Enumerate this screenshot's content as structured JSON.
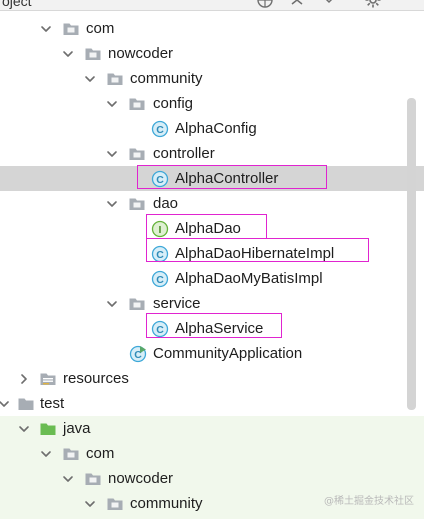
{
  "panel": {
    "title": "oject",
    "toolbar": [
      "globe-icon",
      "collapse-all-icon",
      "settings-icon"
    ]
  },
  "tree": {
    "com": "com",
    "nowcoder": "nowcoder",
    "community": "community",
    "config": "config",
    "alpha_config": "AlphaConfig",
    "controller": "controller",
    "alpha_controller": "AlphaController",
    "dao": "dao",
    "alpha_dao": "AlphaDao",
    "alpha_dao_hibernate_impl": "AlphaDaoHibernateImpl",
    "alpha_dao_mybatis_impl": "AlphaDaoMyBatisImpl",
    "service": "service",
    "alpha_service": "AlphaService",
    "community_application": "CommunityApplication",
    "resources": "resources",
    "test": "test",
    "java": "java",
    "test_com": "com",
    "test_nowcoder": "nowcoder",
    "test_community": "community"
  },
  "watermark": "@稀土掘金技术社区",
  "colors": {
    "highlight_border": "#e024d0",
    "selected_row": "#d5d5d5",
    "test_sources_bg": "#f1f8ec",
    "class_icon": "#3ea8d8",
    "interface_icon": "#65b33a",
    "folder": "#a7adb4",
    "java_folder": "#6abc52"
  }
}
